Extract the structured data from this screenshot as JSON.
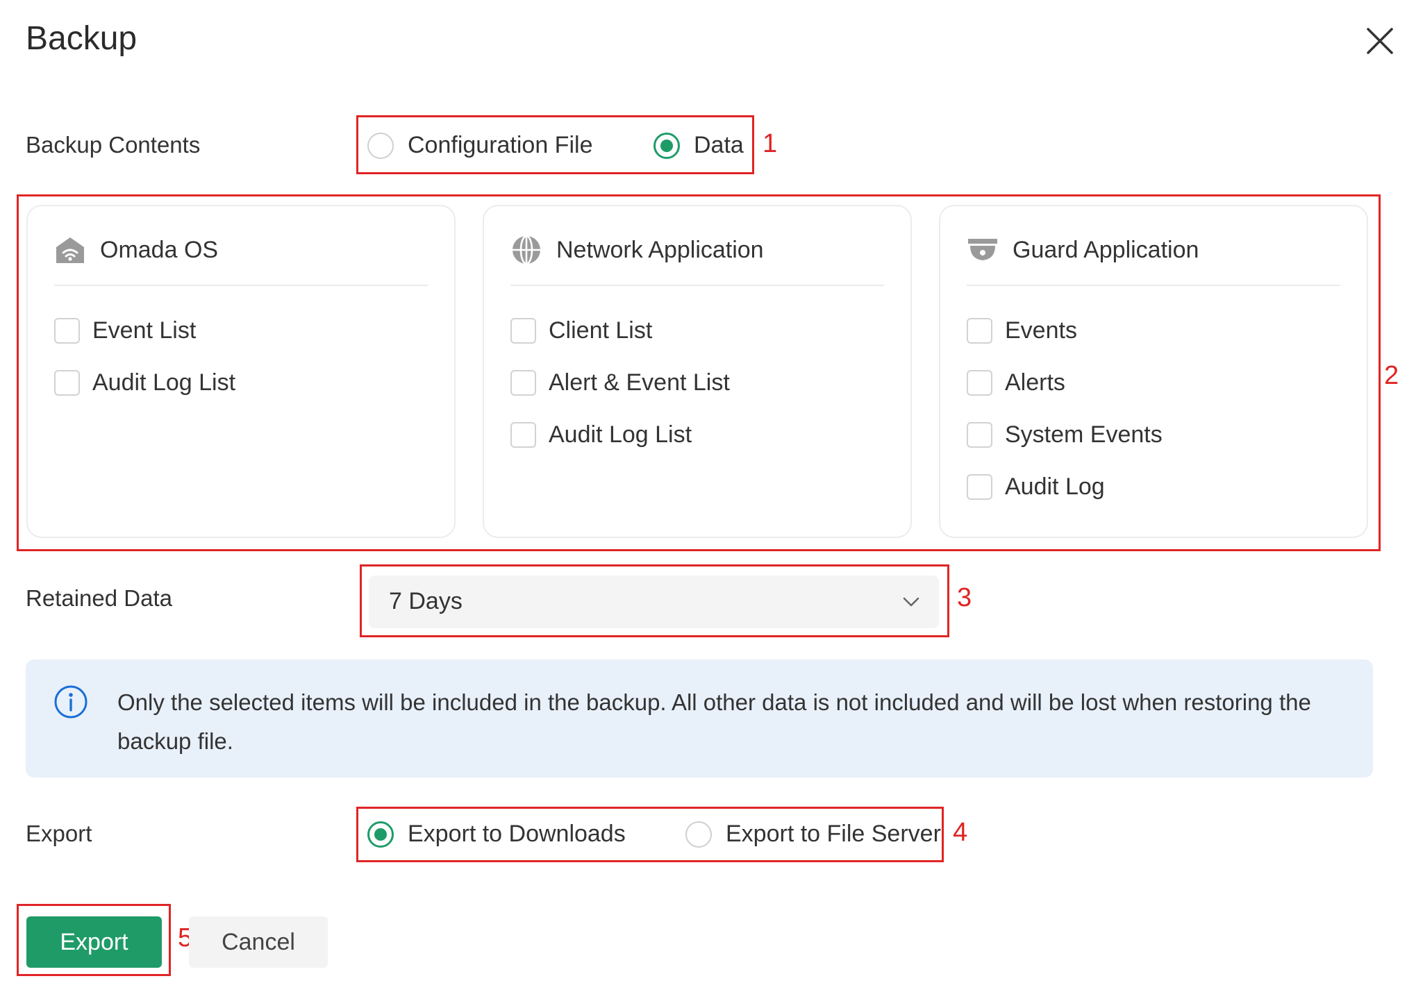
{
  "dialog": {
    "title": "Backup",
    "close_icon": "close-icon"
  },
  "backup_contents": {
    "label": "Backup Contents",
    "options": [
      {
        "label": "Configuration File",
        "checked": false
      },
      {
        "label": "Data",
        "checked": true
      }
    ]
  },
  "modules": [
    {
      "title": "Omada OS",
      "icon": "omada-os-icon",
      "items": [
        {
          "label": "Event List",
          "checked": false
        },
        {
          "label": "Audit Log List",
          "checked": false
        }
      ]
    },
    {
      "title": "Network Application",
      "icon": "globe-icon",
      "items": [
        {
          "label": "Client List",
          "checked": false
        },
        {
          "label": "Alert & Event List",
          "checked": false
        },
        {
          "label": "Audit Log List",
          "checked": false
        }
      ]
    },
    {
      "title": "Guard Application",
      "icon": "camera-icon",
      "items": [
        {
          "label": "Events",
          "checked": false
        },
        {
          "label": "Alerts",
          "checked": false
        },
        {
          "label": "System Events",
          "checked": false
        },
        {
          "label": "Audit Log",
          "checked": false
        }
      ]
    }
  ],
  "retained_data": {
    "label": "Retained Data",
    "value": "7 Days"
  },
  "info": {
    "icon": "info-icon",
    "text": "Only the selected items will be included in the backup. All other data is not included and will be lost when restoring the backup file."
  },
  "export": {
    "label": "Export",
    "options": [
      {
        "label": "Export to Downloads",
        "checked": true
      },
      {
        "label": "Export to File Server",
        "checked": false
      }
    ]
  },
  "buttons": {
    "export": "Export",
    "cancel": "Cancel"
  },
  "markers": [
    "1",
    "2",
    "3",
    "4",
    "5"
  ],
  "colors": {
    "accent": "#1f9b68",
    "annotation": "#e02424",
    "info_bg": "#e8f0fa",
    "info_icon": "#1a6fd6"
  }
}
